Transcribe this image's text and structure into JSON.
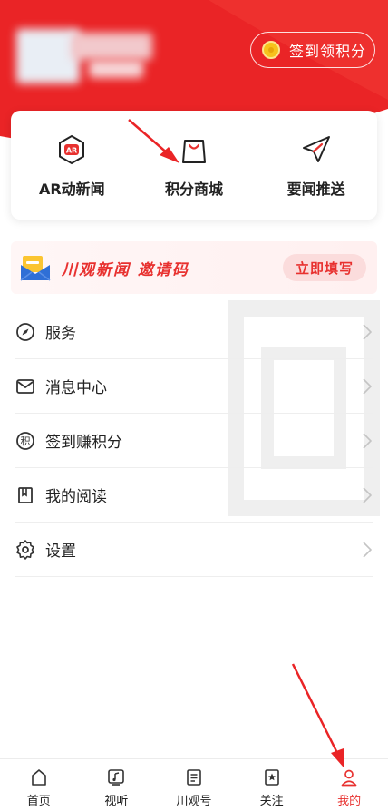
{
  "header": {
    "checkin_label": "签到领积分",
    "bg_color": "#ea2426"
  },
  "quick_actions": [
    {
      "label": "AR动新闻",
      "icon": "ar-icon"
    },
    {
      "label": "积分商城",
      "icon": "shopping-bag-icon"
    },
    {
      "label": "要闻推送",
      "icon": "send-icon"
    }
  ],
  "invite": {
    "text": "川观新闻  邀请码",
    "button_label": "立即填写"
  },
  "menu": [
    {
      "label": "服务",
      "icon": "compass-icon"
    },
    {
      "label": "消息中心",
      "icon": "mail-icon"
    },
    {
      "label": "签到赚积分",
      "icon": "points-icon",
      "icon_glyph": "积"
    },
    {
      "label": "我的阅读",
      "icon": "bookmark-book-icon"
    },
    {
      "label": "设置",
      "icon": "gear-icon"
    }
  ],
  "tabbar": {
    "active": "我的",
    "accent": "#e8312f",
    "items": [
      {
        "label": "首页",
        "icon": "home-icon"
      },
      {
        "label": "视听",
        "icon": "media-icon"
      },
      {
        "label": "川观号",
        "icon": "profile-card-icon"
      },
      {
        "label": "关注",
        "icon": "star-bookmark-icon"
      },
      {
        "label": "我的",
        "icon": "person-icon"
      }
    ]
  }
}
